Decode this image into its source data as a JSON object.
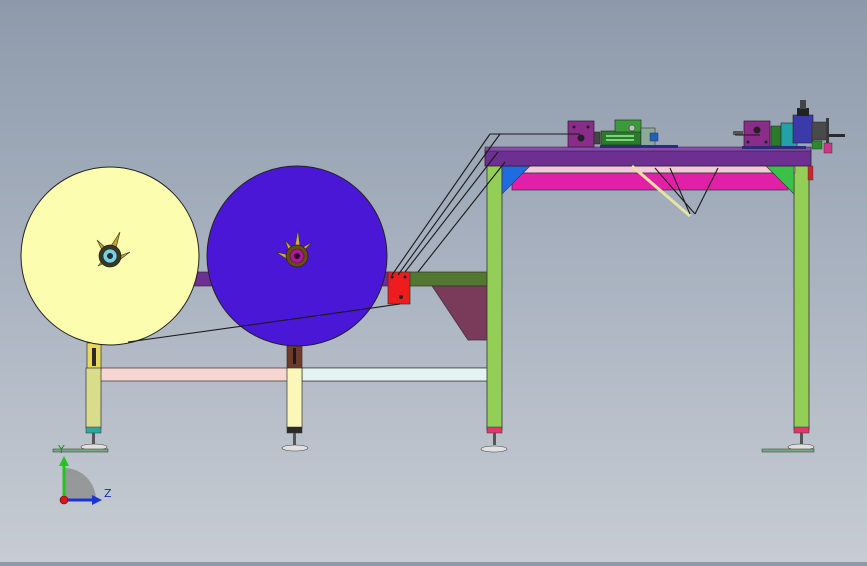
{
  "viewport": {
    "background_top": "#8e9aab",
    "background_bottom": "#c7ccd3"
  },
  "triad": {
    "y_label": "Y",
    "z_label": "Z",
    "y_color": "#27c21f",
    "z_color": "#1a35d6",
    "x_color": "#d21a1a"
  },
  "model": {
    "roll_1_color": "#fdfdb0",
    "roll_2_color": "#4a17d6",
    "frame_column_color": "#93cf57",
    "beam_purple": "#6d2f92",
    "beam_magenta": "#e021a8",
    "bracket_red": "#ee1c1c",
    "gusset_color": "#7a3b5a"
  }
}
